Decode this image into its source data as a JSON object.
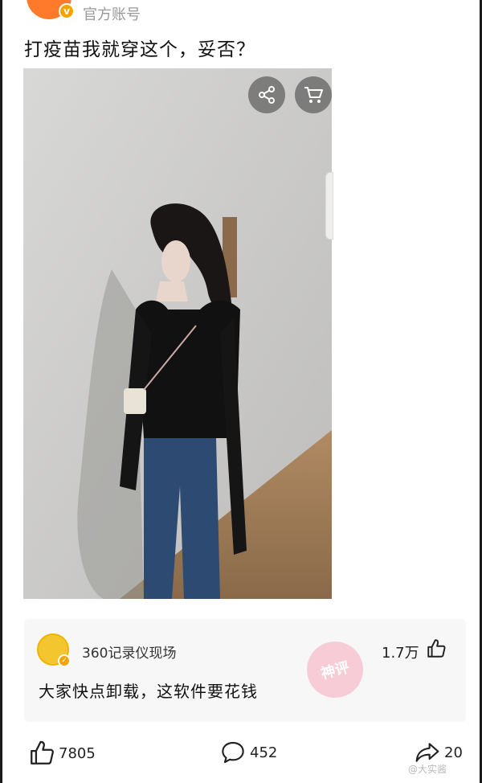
{
  "header": {
    "account_name": "官方账号",
    "avatar_badge": "v"
  },
  "post": {
    "title": "打疫苗我就穿这个，妥否？"
  },
  "photo": {
    "share_icon": "share-icon",
    "cart_icon": "cart-icon"
  },
  "comment": {
    "author": "360记录仪现场",
    "likes": "1.7万",
    "text": "大家快点卸载，这软件要花钱",
    "badge": "神评"
  },
  "actions": {
    "likes": "7805",
    "comments": "452",
    "shares": "20"
  },
  "watermark": "@大实酱",
  "colors": {
    "accent": "#ff7a2a",
    "verified": "#f5a300",
    "card_bg": "#f7f7f7"
  }
}
